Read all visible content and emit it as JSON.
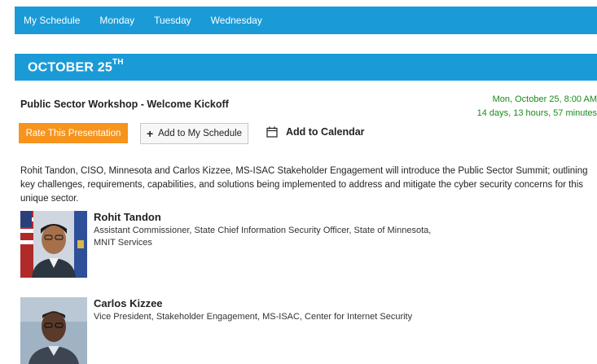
{
  "nav": {
    "items": [
      "My Schedule",
      "Monday",
      "Tuesday",
      "Wednesday"
    ]
  },
  "day": {
    "label": "OCTOBER 25",
    "suffix": "TH"
  },
  "session": {
    "title": "Public Sector Workshop - Welcome Kickoff",
    "datetime": "Mon, October 25, 8:00 AM",
    "countdown": "14 days, 13 hours, 57 minutes",
    "rate_label": "Rate This Presentation",
    "add_schedule_label": "Add to My Schedule",
    "add_calendar_label": "Add to Calendar",
    "description": "Rohit Tandon, CISO, Minnesota and Carlos Kizzee, MS-ISAC Stakeholder Engagement will introduce the Public Sector Summit; outlining key challenges, requirements, capabilities, and solutions being implemented to address and mitigate the cyber security concerns for this unique sector."
  },
  "speakers": [
    {
      "name": "Rohit Tandon",
      "title": "Assistant Commissioner, State Chief Information Security Officer, State of Minnesota, MNIT Services"
    },
    {
      "name": "Carlos Kizzee",
      "title": "Vice President, Stakeholder Engagement, MS-ISAC, Center for Internet Security"
    }
  ],
  "colors": {
    "brand_blue": "#1a9bd7",
    "rate_orange": "#f7941d",
    "time_green": "#1a8a1a"
  },
  "icons": {
    "calendar": "calendar-icon",
    "plus": "plus-icon"
  }
}
